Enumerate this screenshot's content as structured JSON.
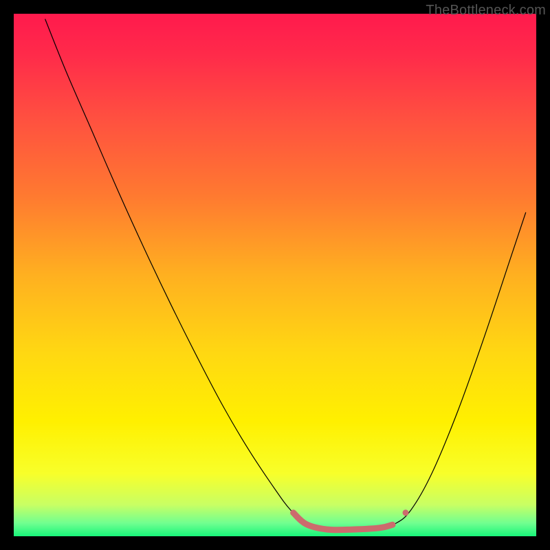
{
  "watermark": "TheBottleneck.com",
  "chart_data": {
    "type": "line",
    "xlim": [
      0,
      100
    ],
    "ylim": [
      0,
      100
    ],
    "grid": false,
    "background_gradient_stops": [
      {
        "offset": 0.0,
        "color": "#ff1a4d"
      },
      {
        "offset": 0.08,
        "color": "#ff2b4a"
      },
      {
        "offset": 0.2,
        "color": "#ff5040"
      },
      {
        "offset": 0.35,
        "color": "#ff7a30"
      },
      {
        "offset": 0.5,
        "color": "#ffb020"
      },
      {
        "offset": 0.65,
        "color": "#ffd812"
      },
      {
        "offset": 0.78,
        "color": "#fff000"
      },
      {
        "offset": 0.88,
        "color": "#f8ff2a"
      },
      {
        "offset": 0.94,
        "color": "#c8ff64"
      },
      {
        "offset": 0.975,
        "color": "#70ff90"
      },
      {
        "offset": 1.0,
        "color": "#18f57a"
      }
    ],
    "series": [
      {
        "name": "thin-curve",
        "stroke": "#000000",
        "stroke_width": 1.2,
        "points": [
          {
            "x": 6.0,
            "y": 99.0
          },
          {
            "x": 10.0,
            "y": 89.0
          },
          {
            "x": 15.0,
            "y": 77.5
          },
          {
            "x": 20.0,
            "y": 66.0
          },
          {
            "x": 25.0,
            "y": 55.0
          },
          {
            "x": 30.0,
            "y": 44.5
          },
          {
            "x": 35.0,
            "y": 34.5
          },
          {
            "x": 40.0,
            "y": 25.0
          },
          {
            "x": 45.0,
            "y": 16.5
          },
          {
            "x": 50.0,
            "y": 9.0
          },
          {
            "x": 53.0,
            "y": 5.0
          },
          {
            "x": 56.0,
            "y": 2.3
          },
          {
            "x": 60.0,
            "y": 1.3
          },
          {
            "x": 65.0,
            "y": 1.3
          },
          {
            "x": 70.0,
            "y": 1.6
          },
          {
            "x": 73.0,
            "y": 2.4
          },
          {
            "x": 76.0,
            "y": 5.0
          },
          {
            "x": 80.0,
            "y": 12.0
          },
          {
            "x": 85.0,
            "y": 24.0
          },
          {
            "x": 90.0,
            "y": 38.0
          },
          {
            "x": 95.0,
            "y": 53.0
          },
          {
            "x": 98.0,
            "y": 62.0
          }
        ]
      },
      {
        "name": "thick-highlight",
        "stroke": "#cc6b6d",
        "stroke_width": 9,
        "linecap": "round",
        "points": [
          {
            "x": 53.5,
            "y": 4.5
          },
          {
            "x": 56.0,
            "y": 2.3
          },
          {
            "x": 60.0,
            "y": 1.3
          },
          {
            "x": 65.0,
            "y": 1.3
          },
          {
            "x": 70.0,
            "y": 1.6
          },
          {
            "x": 72.5,
            "y": 2.2
          }
        ]
      }
    ],
    "markers": [
      {
        "name": "highlight-dot",
        "x": 75.0,
        "y": 4.5,
        "r": 4.5,
        "fill": "#cc6b6d"
      }
    ]
  }
}
